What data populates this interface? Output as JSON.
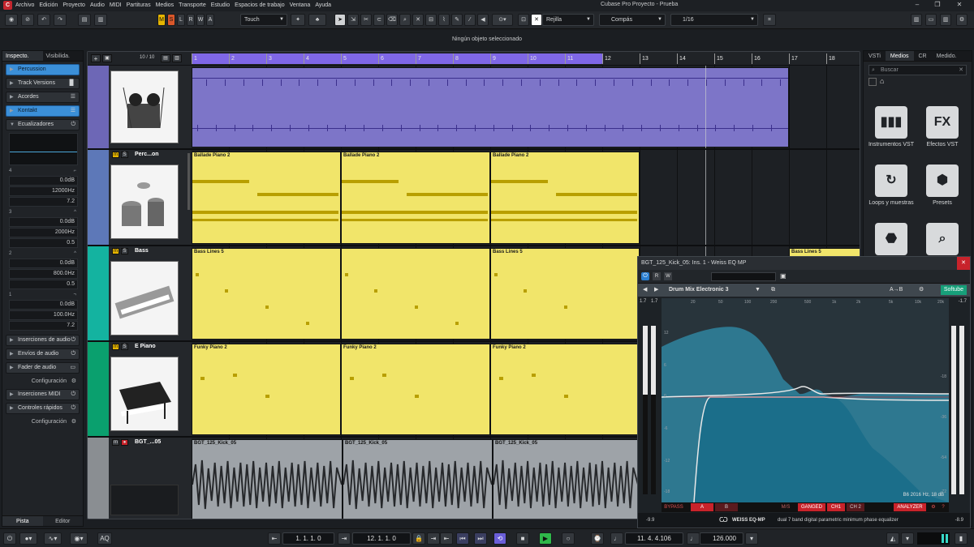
{
  "menubar": {
    "app_icon": "C",
    "items": [
      "Archivo",
      "Edición",
      "Proyecto",
      "Audio",
      "MIDI",
      "Partituras",
      "Medios",
      "Transporte",
      "Estudio",
      "Espacios de trabajo",
      "Ventana",
      "Ayuda"
    ],
    "title": "Cubase Pro Proyecto - Prueba"
  },
  "toolbar": {
    "m": "M",
    "s": "S",
    "l": "L",
    "r": "R",
    "w": "W",
    "a": "A",
    "automation_mode": "Touch",
    "snap_type": "Rejilla",
    "grid_type": "Compás",
    "quantize": "1/16"
  },
  "status": {
    "selection": "Ningún objeto seleccionado"
  },
  "inspector": {
    "tabs": [
      "Inspecto.",
      "Visibilida."
    ],
    "sections": {
      "percussion": "Percussion",
      "track_versions": "Track Versions",
      "chords": "Acordes",
      "kontakt": "Kontakt",
      "equalizers": "Ecualizadores",
      "audio_inserts": "Inserciones de audio",
      "audio_sends": "Envíos de audio",
      "audio_fader": "Fader de audio",
      "config1": "Configuración",
      "midi_inserts": "Inserciones MIDI",
      "quick_controls": "Controles rápidos",
      "config2": "Configuración"
    },
    "eq_bands": [
      {
        "label": "4",
        "gain": "0.0dB",
        "freq": "12000Hz",
        "q": "7.2"
      },
      {
        "label": "3",
        "gain": "0.0dB",
        "freq": "2000Hz",
        "q": "0.5"
      },
      {
        "label": "2",
        "gain": "0.0dB",
        "freq": "800.0Hz",
        "q": "0.5"
      },
      {
        "label": "1",
        "gain": "0.0dB",
        "freq": "100.0Hz",
        "q": "7.2"
      }
    ],
    "bottom_tabs": [
      "Pista",
      "Editor"
    ]
  },
  "project": {
    "track_count": "10 / 10",
    "ruler": [
      "1",
      "2",
      "3",
      "4",
      "5",
      "6",
      "7",
      "8",
      "9",
      "10",
      "11",
      "12",
      "13",
      "14",
      "15",
      "16",
      "17",
      "18"
    ],
    "tracks": [
      {
        "name": "Perc...on",
        "color": "#6d67b6"
      },
      {
        "name": "Bass",
        "color": "#14b3a0"
      },
      {
        "name": "E Piano",
        "color": "#0aa06e"
      },
      {
        "name": "BGT_...05",
        "color": "#8a8e92"
      }
    ],
    "parts": {
      "piano": [
        "Ballade Piano 2",
        "Ballade Piano 2",
        "Ballade Piano 2"
      ],
      "bass": [
        "Bass Lines 5",
        "Bass Lines 5",
        "Bass Lines 5"
      ],
      "epiano": [
        "Funky Piano 2",
        "Funky Piano 2",
        "Funky Piano 2"
      ],
      "audio": [
        "BGT_125_Kick_05",
        "BGT_125_Kick_05",
        "BGT_125_Kick_05"
      ]
    }
  },
  "media": {
    "tabs": [
      "VSTi",
      "Medios",
      "CR",
      "Medido."
    ],
    "search_placeholder": "Buscar",
    "tiles": [
      {
        "label": "Instrumentos VST",
        "glyph": "▮▮▮"
      },
      {
        "label": "Efectos VST",
        "glyph": "FX"
      },
      {
        "label": "Loops y muestras",
        "glyph": "↻"
      },
      {
        "label": "Presets",
        "glyph": "⬢"
      }
    ]
  },
  "plugin": {
    "title": "BGT_125_Kick_05: Ins. 1 - Weiss EQ MP",
    "preset": "Drum Mix Electronic 3",
    "brand": "Softube",
    "meter_left": "1.7",
    "meter_left2": "1.7",
    "meter_right": "-1.7",
    "freq_labels": [
      "20",
      "50",
      "100",
      "200",
      "500",
      "1k",
      "2k",
      "5k",
      "10k",
      "20k"
    ],
    "db_labels": [
      "12",
      "6",
      "0",
      "-6",
      "-12",
      "-18"
    ],
    "db_labels_right": [
      "-18",
      "-36",
      "-54",
      "-72"
    ],
    "readout": "B6 2016 Hz, 18 dB",
    "buttons": {
      "bypass": "BYPASS",
      "a": "A",
      "b": "B",
      "ms": "M/S",
      "ganged": "GANGED",
      "ch1": "CH1",
      "ch2": "CH 2",
      "analyzer": "ANALYZER"
    },
    "footer_brand": "WEISS EQ-MP",
    "footer_desc": "dual 7 band digital parametric minimum phase equalizer",
    "bottom_left": "-9.9",
    "bottom_right": "-8.9",
    "colors": {
      "fill": "#1b6e8a",
      "accent": "#c8232b"
    }
  },
  "transport": {
    "left_locator": "1. 1. 1. 0",
    "right_locator": "12. 1. 1. 0",
    "position": "11. 4. 4.106",
    "tempo": "126.000"
  }
}
